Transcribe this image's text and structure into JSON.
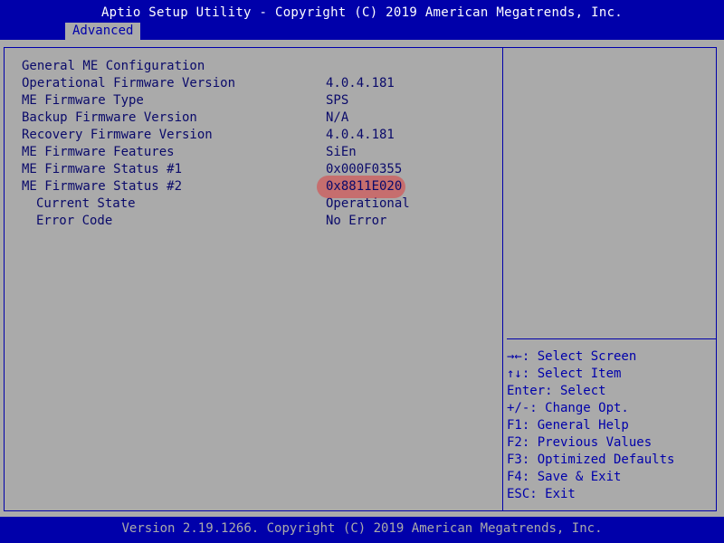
{
  "header": {
    "title": "Aptio Setup Utility - Copyright (C) 2019 American Megatrends, Inc.",
    "tab": "Advanced"
  },
  "main": {
    "section_title": "General ME Configuration",
    "rows": [
      {
        "label": "Operational Firmware Version",
        "value": "4.0.4.181"
      },
      {
        "label": "ME Firmware Type",
        "value": "SPS"
      },
      {
        "label": "Backup Firmware Version",
        "value": "N/A"
      },
      {
        "label": "Recovery Firmware Version",
        "value": "4.0.4.181"
      },
      {
        "label": "ME Firmware Features",
        "value": "SiEn"
      },
      {
        "label": "ME Firmware Status #1",
        "value": "0x000F0355"
      },
      {
        "label": "ME Firmware Status #2",
        "value": "0x8811E020"
      },
      {
        "label": "Current State",
        "value": "Operational"
      },
      {
        "label": "Error Code",
        "value": "No Error"
      }
    ]
  },
  "help": {
    "items": [
      "→←: Select Screen",
      "↑↓: Select Item",
      "Enter: Select",
      "+/-: Change Opt.",
      "F1: General Help",
      "F2: Previous Values",
      "F3: Optimized Defaults",
      "F4: Save & Exit",
      "ESC: Exit"
    ]
  },
  "footer": {
    "text": "Version 2.19.1266. Copyright (C) 2019 American Megatrends, Inc."
  },
  "colors": {
    "background": "#0000aa",
    "panel": "#aaaaaa",
    "highlight": "#dc3c3c"
  }
}
